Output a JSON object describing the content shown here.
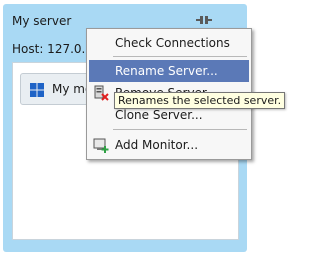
{
  "server": {
    "name": "My server",
    "host": "Host: 127.0.0.1",
    "connector_icon": "plug-connector-icon"
  },
  "monitor": {
    "label": "My monitor",
    "icon": "windows-icon"
  },
  "context_menu": {
    "items": [
      {
        "label": "Check Connections",
        "icon": null,
        "highlighted": false
      },
      {
        "label": "Rename Server...",
        "icon": null,
        "highlighted": true
      },
      {
        "label": "Remove Server",
        "icon": "remove-server-icon",
        "highlighted": false
      },
      {
        "label": "Clone Server...",
        "icon": null,
        "highlighted": false
      },
      {
        "label": "Add Monitor...",
        "icon": "add-monitor-icon",
        "highlighted": false
      }
    ]
  },
  "tooltip": {
    "text": "Renames the selected server."
  },
  "colors": {
    "card_background": "#a9d9f4",
    "menu_highlight": "#5b79b7",
    "tooltip_background": "#ffffe1"
  }
}
